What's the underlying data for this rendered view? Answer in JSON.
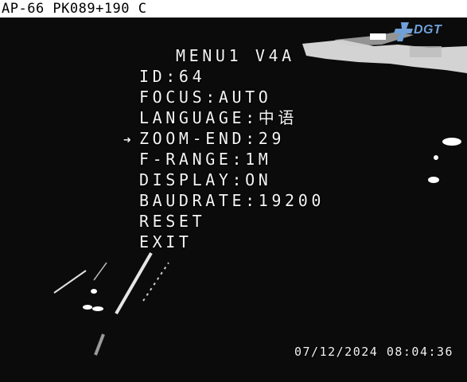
{
  "camera_label": "AP-66 PK089+190 C",
  "logo": {
    "text": "DGT",
    "color": "#6fa0d8"
  },
  "menu": {
    "title": "MENU1 V4A",
    "cursor_icon": "arrow-right-icon",
    "selected_index": 3,
    "items": [
      {
        "label": "ID:64"
      },
      {
        "label": "FOCUS:AUTO"
      },
      {
        "label": "LANGUAGE:中语"
      },
      {
        "label": "ZOOM-END:29"
      },
      {
        "label": "F-RANGE:1M"
      },
      {
        "label": "DISPLAY:ON"
      },
      {
        "label": "BAUDRATE:19200"
      },
      {
        "label": "RESET"
      },
      {
        "label": "EXIT"
      }
    ]
  },
  "timestamp": "07/12/2024 08:04:36",
  "colors": {
    "osd_text": "#f4f4f4",
    "background": "#0b0b0b",
    "top_bar": "#ffffff"
  }
}
